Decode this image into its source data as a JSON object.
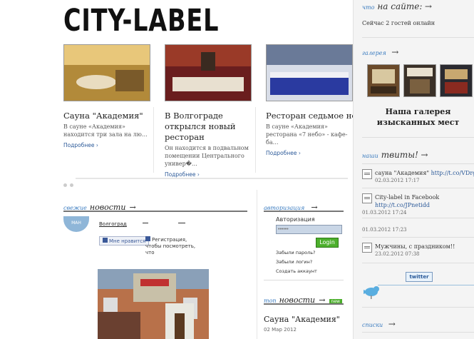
{
  "site": {
    "logo": "CITY-LABEL"
  },
  "cards": [
    {
      "title": "Сауна \"Академия\"",
      "excerpt": "В сауне «Академия» находится три зала на лю…",
      "more": "Подробнее ›"
    },
    {
      "title": "В Волгограде открылся новый ресторан",
      "excerpt": "Он находится в подвальном помещении Центрального универ�…",
      "more": "Подробнее ›"
    },
    {
      "title": "Ресторан седьмое неб",
      "excerpt": "В сауне «Академия» ресторана «7 небо» - кафе-ба…",
      "more": "Подробнее ›"
    }
  ],
  "news": {
    "small": "свежие",
    "big": "новости",
    "arrow": "→",
    "city": "Волгоград",
    "like_label": "Мне нравится",
    "register_text": "Регистрация, чтобы посмотреть, что",
    "map_label": "МАН"
  },
  "auth": {
    "small": "авторизация",
    "arrow": "→",
    "label": "Авторизация",
    "password_placeholder": "••••••",
    "login_button": "Login",
    "links": [
      "Забыли пароль?",
      "Забыли логин?",
      "Создать аккаунт"
    ]
  },
  "top_news": {
    "small": "топ",
    "big": "новости",
    "arrow": "→",
    "badge": "new",
    "title": "Сауна \"Академия\"",
    "date": "02 Мар 2012"
  },
  "sidebar": {
    "on_site": {
      "small": "что",
      "big": "на сайте:",
      "arrow": "→",
      "text": "Сейчас 2 гостей онлайн"
    },
    "gallery": {
      "small": "галерея",
      "arrow": "→",
      "caption": "Наша галерея изысканных мест"
    },
    "tweets": {
      "small": "наши",
      "big": "твиты!",
      "arrow": "→",
      "items": [
        {
          "text": "сауна \"Академия\" ",
          "link": "http://t.co/VDrgtto",
          "date": "02.03.2012 17:17"
        },
        {
          "text": "City-label in Facebook ",
          "link": "http://t.co/JPnetidd",
          "date": "01.03.2012 17:24"
        },
        {
          "text": "",
          "link": "",
          "date": "01.03.2012 17:23"
        },
        {
          "text": "Мужчины, с праздником!!",
          "link": "",
          "date": "23.02.2012 07:38"
        }
      ],
      "badge": "twitter"
    },
    "lists": {
      "small": "списки",
      "arrow": "→"
    }
  },
  "colors": {
    "accent": "#3a7bbf",
    "login_green": "#4caf2c",
    "sidebar_bg": "#f4f4f4"
  }
}
